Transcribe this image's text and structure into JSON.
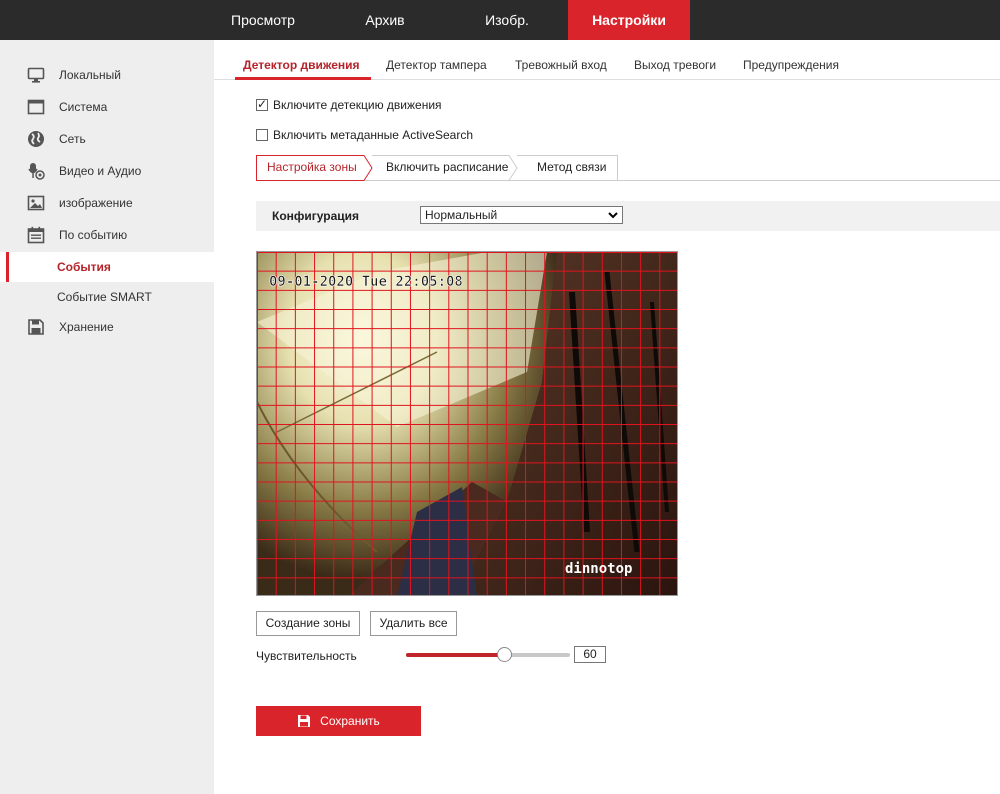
{
  "top_nav": {
    "items": [
      {
        "label": "Просмотр"
      },
      {
        "label": "Архив"
      },
      {
        "label": "Изобр."
      },
      {
        "label": "Настройки"
      }
    ],
    "active_index": 3
  },
  "sidebar": {
    "items": [
      {
        "label": "Локальный",
        "icon": "monitor-icon"
      },
      {
        "label": "Система",
        "icon": "window-icon"
      },
      {
        "label": "Сеть",
        "icon": "globe-icon"
      },
      {
        "label": "Видео и Аудио",
        "icon": "microphone-icon"
      },
      {
        "label": "изображение",
        "icon": "image-icon"
      },
      {
        "label": "По событию",
        "icon": "calendar-icon"
      },
      {
        "label": "События",
        "icon": ""
      },
      {
        "label": "Событие SMART",
        "icon": ""
      },
      {
        "label": "Хранение",
        "icon": "floppy-disk-icon"
      }
    ],
    "active_label": "События"
  },
  "main_tabs": {
    "items": [
      {
        "label": "Детектор движения"
      },
      {
        "label": "Детектор тампера"
      },
      {
        "label": "Тревожный вход"
      },
      {
        "label": "Выход тревоги"
      },
      {
        "label": "Предупреждения"
      }
    ],
    "active_index": 0
  },
  "options": {
    "enable_motion": {
      "label": "Включите детекцию движения",
      "checked": true
    },
    "enable_metadata": {
      "label": "Включить метаданные ActiveSearch",
      "checked": false
    }
  },
  "sub_tabs": {
    "items": [
      {
        "label": "Настройка зоны"
      },
      {
        "label": "Включить расписание"
      },
      {
        "label": "Метод связи"
      }
    ],
    "active_index": 0
  },
  "config": {
    "label": "Конфигурация",
    "selected": "Нормальный"
  },
  "video": {
    "timestamp": "09-01-2020 Tue 22:05:08",
    "watermark": "dinnotop",
    "grid_color": "#e0141e",
    "grid_columns": 22,
    "grid_rows": 18
  },
  "buttons": {
    "create_zone": "Создание зоны",
    "delete_all": "Удалить все",
    "save": "Сохранить"
  },
  "sensitivity": {
    "label": "Чувствительность",
    "value": "60",
    "min": 0,
    "max": 100
  },
  "colors": {
    "accent": "#d9242b",
    "topbar": "#2b2b2b",
    "sidebar": "#eeeeee"
  }
}
